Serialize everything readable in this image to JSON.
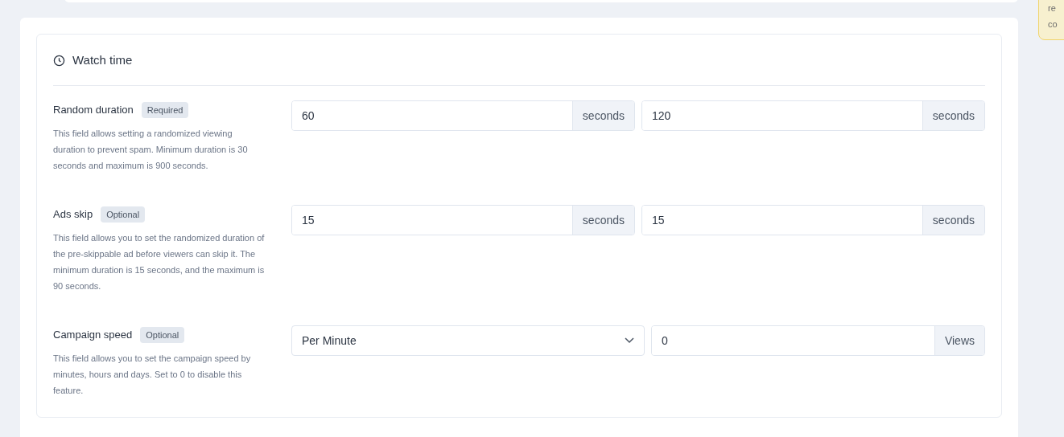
{
  "section": {
    "title": "Watch time"
  },
  "rows": [
    {
      "label": "Random duration",
      "badge": "Required",
      "description": "This field allows setting a randomized viewing duration to prevent spam. Minimum duration is 30 seconds and maximum is 900 seconds.",
      "inputs": [
        {
          "kind": "number",
          "value": "60",
          "unit": "seconds"
        },
        {
          "kind": "number",
          "value": "120",
          "unit": "seconds"
        }
      ]
    },
    {
      "label": "Ads skip",
      "badge": "Optional",
      "description": "This field allows you to set the randomized duration of the pre-skippable ad before viewers can skip it. The minimum duration is 15 seconds, and the maximum is 90 seconds.",
      "inputs": [
        {
          "kind": "number",
          "value": "15",
          "unit": "seconds"
        },
        {
          "kind": "number",
          "value": "15",
          "unit": "seconds"
        }
      ]
    },
    {
      "label": "Campaign speed",
      "badge": "Optional",
      "description": "This field allows you to set the campaign speed by minutes, hours and days. Set to 0 to disable this feature.",
      "inputs": [
        {
          "kind": "select",
          "value": "Per Minute"
        },
        {
          "kind": "number",
          "value": "0",
          "unit": "Views"
        }
      ]
    }
  ],
  "note": {
    "lines": [
      "re",
      "co"
    ]
  }
}
